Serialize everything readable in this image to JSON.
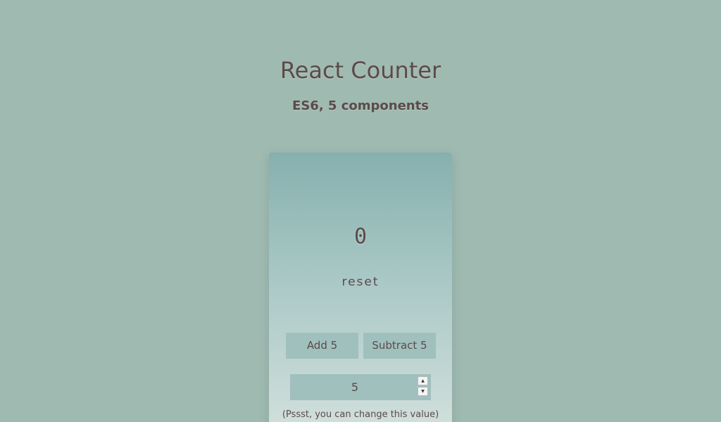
{
  "header": {
    "title": "React Counter",
    "subtitle": "ES6, 5 components"
  },
  "counter": {
    "value": "0",
    "reset_label": "reset"
  },
  "actions": {
    "add_label": "Add 5",
    "subtract_label": "Subtract 5"
  },
  "step_input": {
    "value": "5",
    "up_icon": "triangle-up-icon",
    "down_icon": "triangle-down-icon",
    "up_glyph": "▲",
    "down_glyph": "▼"
  },
  "hint": "(Pssst, you can change this value)",
  "colors": {
    "background": "#9fbab1",
    "text": "#5c4a4a",
    "card_top": "#86b0ae",
    "card_bottom": "#d2e0dd",
    "button": "#a0c0bd"
  }
}
